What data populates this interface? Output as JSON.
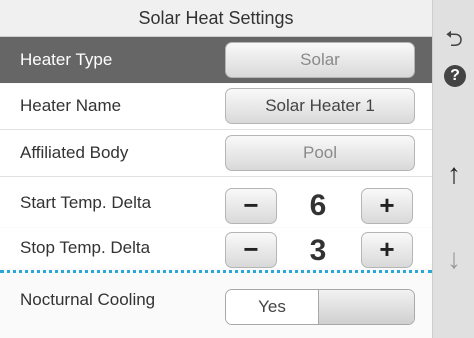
{
  "header": {
    "title": "Solar Heat Settings"
  },
  "rows": {
    "heater_type": {
      "label": "Heater Type",
      "value": "Solar"
    },
    "heater_name": {
      "label": "Heater Name",
      "value": "Solar Heater 1"
    },
    "affiliated_body": {
      "label": "Affiliated Body",
      "value": "Pool"
    },
    "start_delta": {
      "label": "Start Temp. Delta",
      "value": "6",
      "minus": "−",
      "plus": "+"
    },
    "stop_delta": {
      "label": "Stop Temp. Delta",
      "value": "3",
      "minus": "−",
      "plus": "+"
    },
    "nocturnal_cooling": {
      "label": "Nocturnal Cooling",
      "value": "Yes"
    }
  },
  "sidebar": {
    "back": "⮌",
    "help": "?",
    "up": "↑",
    "down": "↓"
  },
  "colors": {
    "selected_row": "#666666",
    "divider": "#2aa7d6",
    "sidebar": "#e0e0e0"
  }
}
